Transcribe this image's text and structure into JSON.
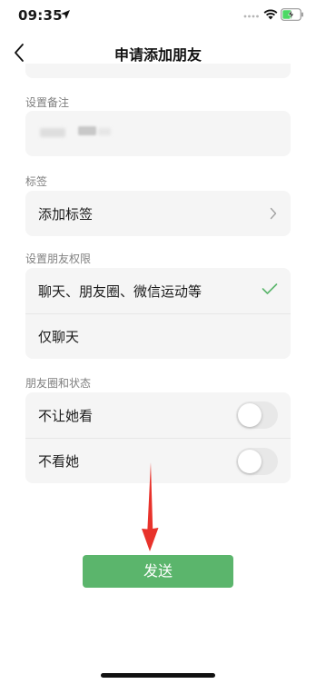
{
  "status_bar": {
    "time": "09:35",
    "icons": [
      "location-arrow-icon",
      "signal-dots-icon",
      "wifi-icon",
      "battery-charging-icon"
    ]
  },
  "nav": {
    "title": "申请添加朋友",
    "back_icon": "chevron-left-icon"
  },
  "remark": {
    "label": "设置备注"
  },
  "tags": {
    "label": "标签",
    "row_label": "添加标签",
    "icon": "chevron-right-icon"
  },
  "permissions": {
    "label": "设置朋友权限",
    "options": [
      {
        "label": "聊天、朋友圈、微信运动等",
        "selected": true
      },
      {
        "label": "仅聊天",
        "selected": false
      }
    ],
    "check_color": "#5bb56c"
  },
  "moments": {
    "label": "朋友圈和状态",
    "toggles": [
      {
        "label": "不让她看",
        "on": false
      },
      {
        "label": "不看她",
        "on": false
      }
    ]
  },
  "send_button": {
    "label": "发送",
    "color": "#5bb56c"
  },
  "annotation": {
    "arrow_color": "#e8322b"
  }
}
